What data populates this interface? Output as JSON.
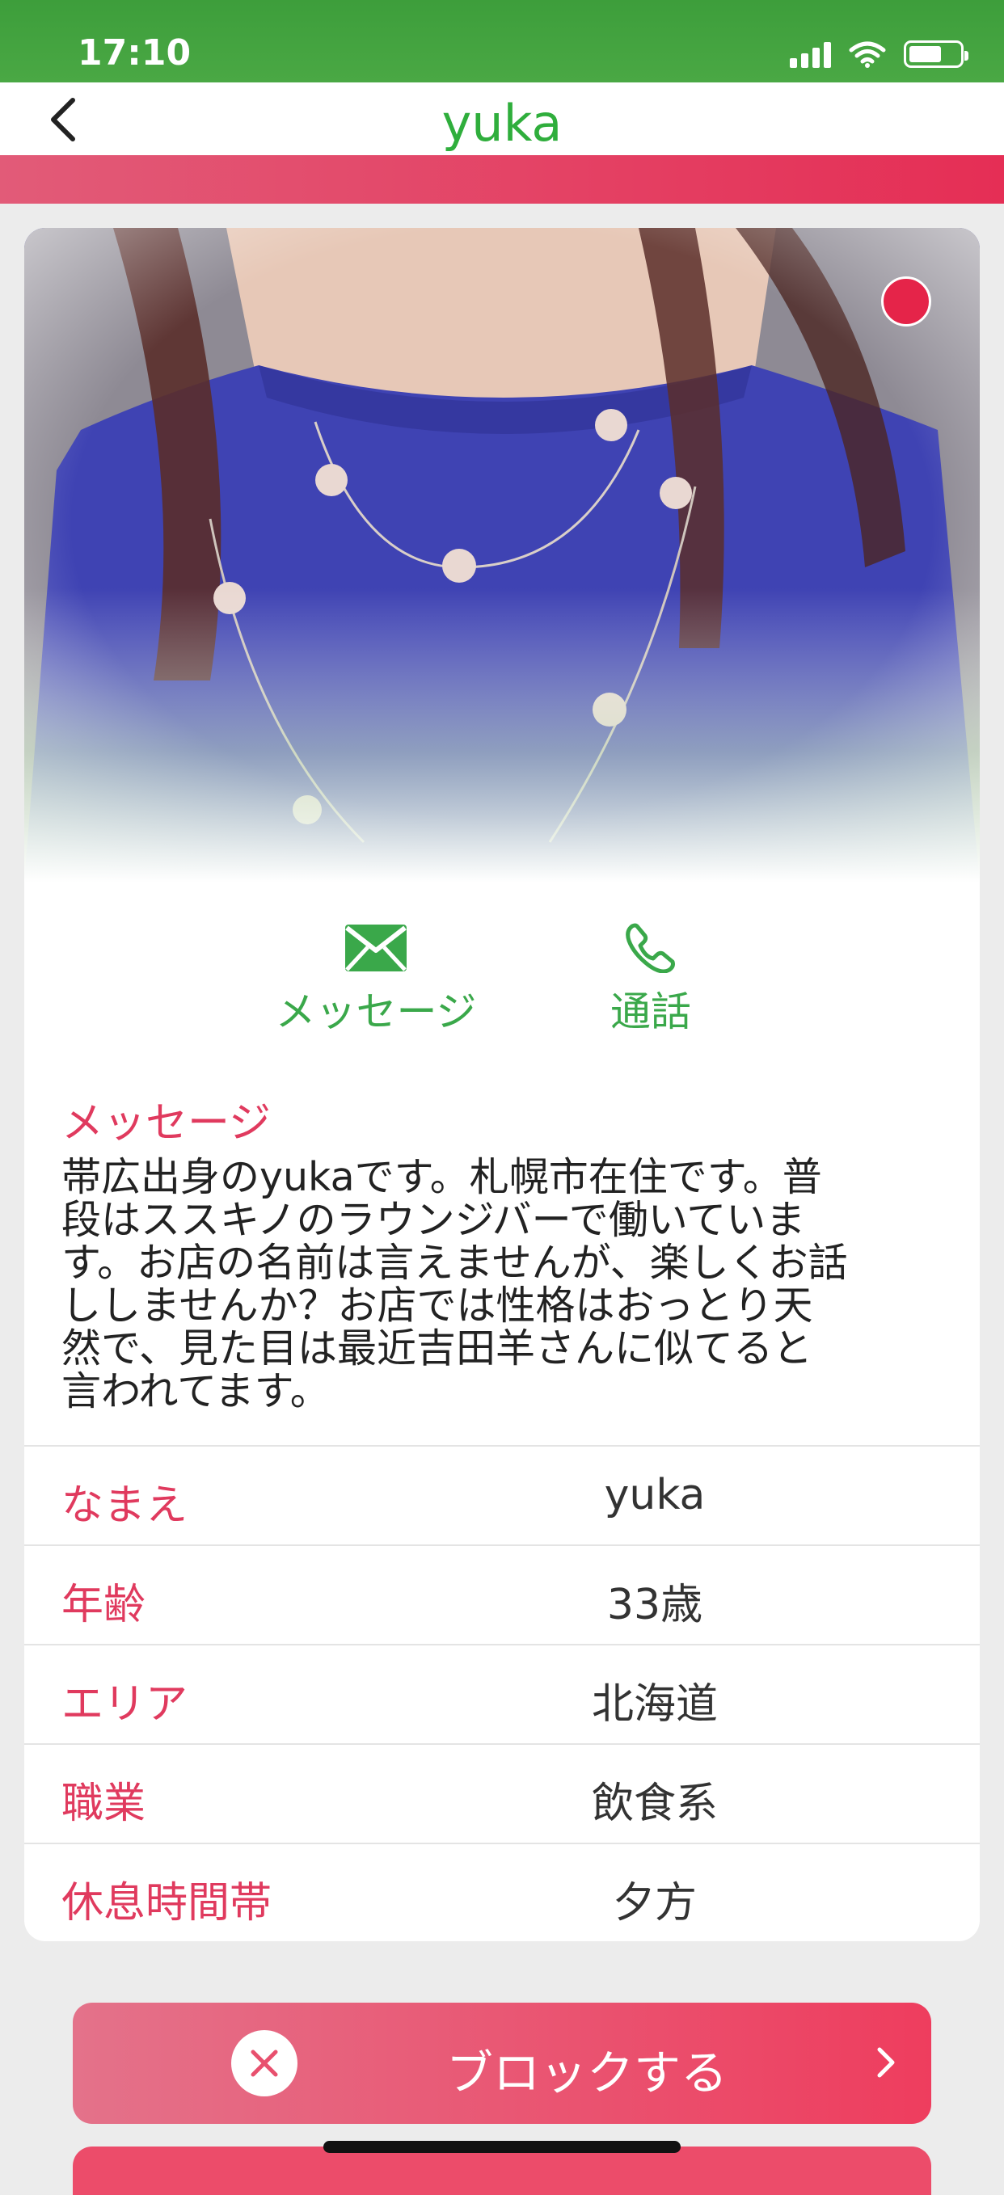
{
  "status_bar": {
    "time": "17:10",
    "icons": [
      "signal-icon",
      "wifi-icon",
      "battery-icon"
    ]
  },
  "nav": {
    "title": "yuka",
    "back_icon": "chevron-left-icon"
  },
  "profile": {
    "online": true,
    "actions": [
      {
        "icon": "envelope-icon",
        "label": "メッセージ"
      },
      {
        "icon": "phone-icon",
        "label": "通話"
      }
    ],
    "message_title": "メッセージ",
    "message_lines": [
      "帯広出身のyukaです。札幌市在住です。普",
      "段はススキノのラウンジバーで働いていま",
      "す。お店の名前は言えませんが、楽しくお話",
      "ししませんか？お店では性格はおっとり天",
      "然で、見た目は最近吉田羊さんに似てると",
      "言われてます。"
    ],
    "info": [
      {
        "key": "なまえ",
        "value": "yuka"
      },
      {
        "key": "年齢",
        "value": "33歳"
      },
      {
        "key": "エリア",
        "value": "北海道"
      },
      {
        "key": "職業",
        "value": "飲食系"
      },
      {
        "key": "休息時間帯",
        "value": "夕方"
      }
    ]
  },
  "block_button": {
    "label": "ブロックする",
    "icon": "close-circle-icon",
    "chevron": "chevron-right-icon"
  },
  "colors": {
    "green": "#3aa84a",
    "pink": "#e03a5e",
    "online": "#e52449"
  }
}
